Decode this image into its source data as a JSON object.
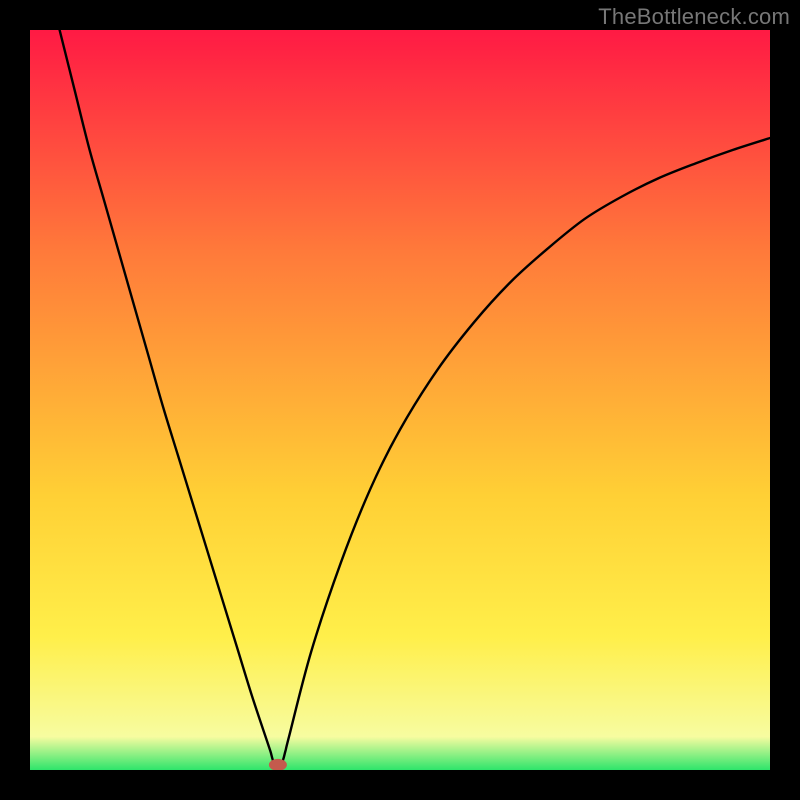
{
  "watermark": {
    "text": "TheBottleneck.com"
  },
  "chart_data": {
    "type": "line",
    "title": "",
    "xlabel": "",
    "ylabel": "",
    "xlim": [
      0,
      100
    ],
    "ylim": [
      0,
      100
    ],
    "grid": false,
    "legend": false,
    "background_gradient_colors": [
      "#ff1a44",
      "#ff7a3a",
      "#ffd035",
      "#ffef4a",
      "#f7fca0",
      "#2ee56b"
    ],
    "series": [
      {
        "name": "curve",
        "x": [
          4,
          6,
          8,
          10,
          12,
          14,
          16,
          18,
          20,
          22,
          24,
          26,
          28,
          30,
          32,
          32.5,
          33,
          34,
          34.5,
          35,
          38,
          42,
          46,
          50,
          55,
          60,
          65,
          70,
          75,
          80,
          85,
          90,
          95,
          100
        ],
        "y": [
          100,
          92,
          84,
          77,
          70,
          63,
          56,
          49,
          42.5,
          36,
          29.5,
          23,
          16.5,
          10,
          4,
          2.5,
          1,
          1,
          2.5,
          4.5,
          16,
          28,
          38,
          46,
          54,
          60.5,
          66,
          70.5,
          74.5,
          77.5,
          80,
          82,
          83.8,
          85.4
        ]
      }
    ],
    "marker": {
      "name": "dot",
      "x": 33.5,
      "y": 0.7,
      "color": "#c45a4d",
      "rx": 9,
      "ry": 6
    }
  }
}
